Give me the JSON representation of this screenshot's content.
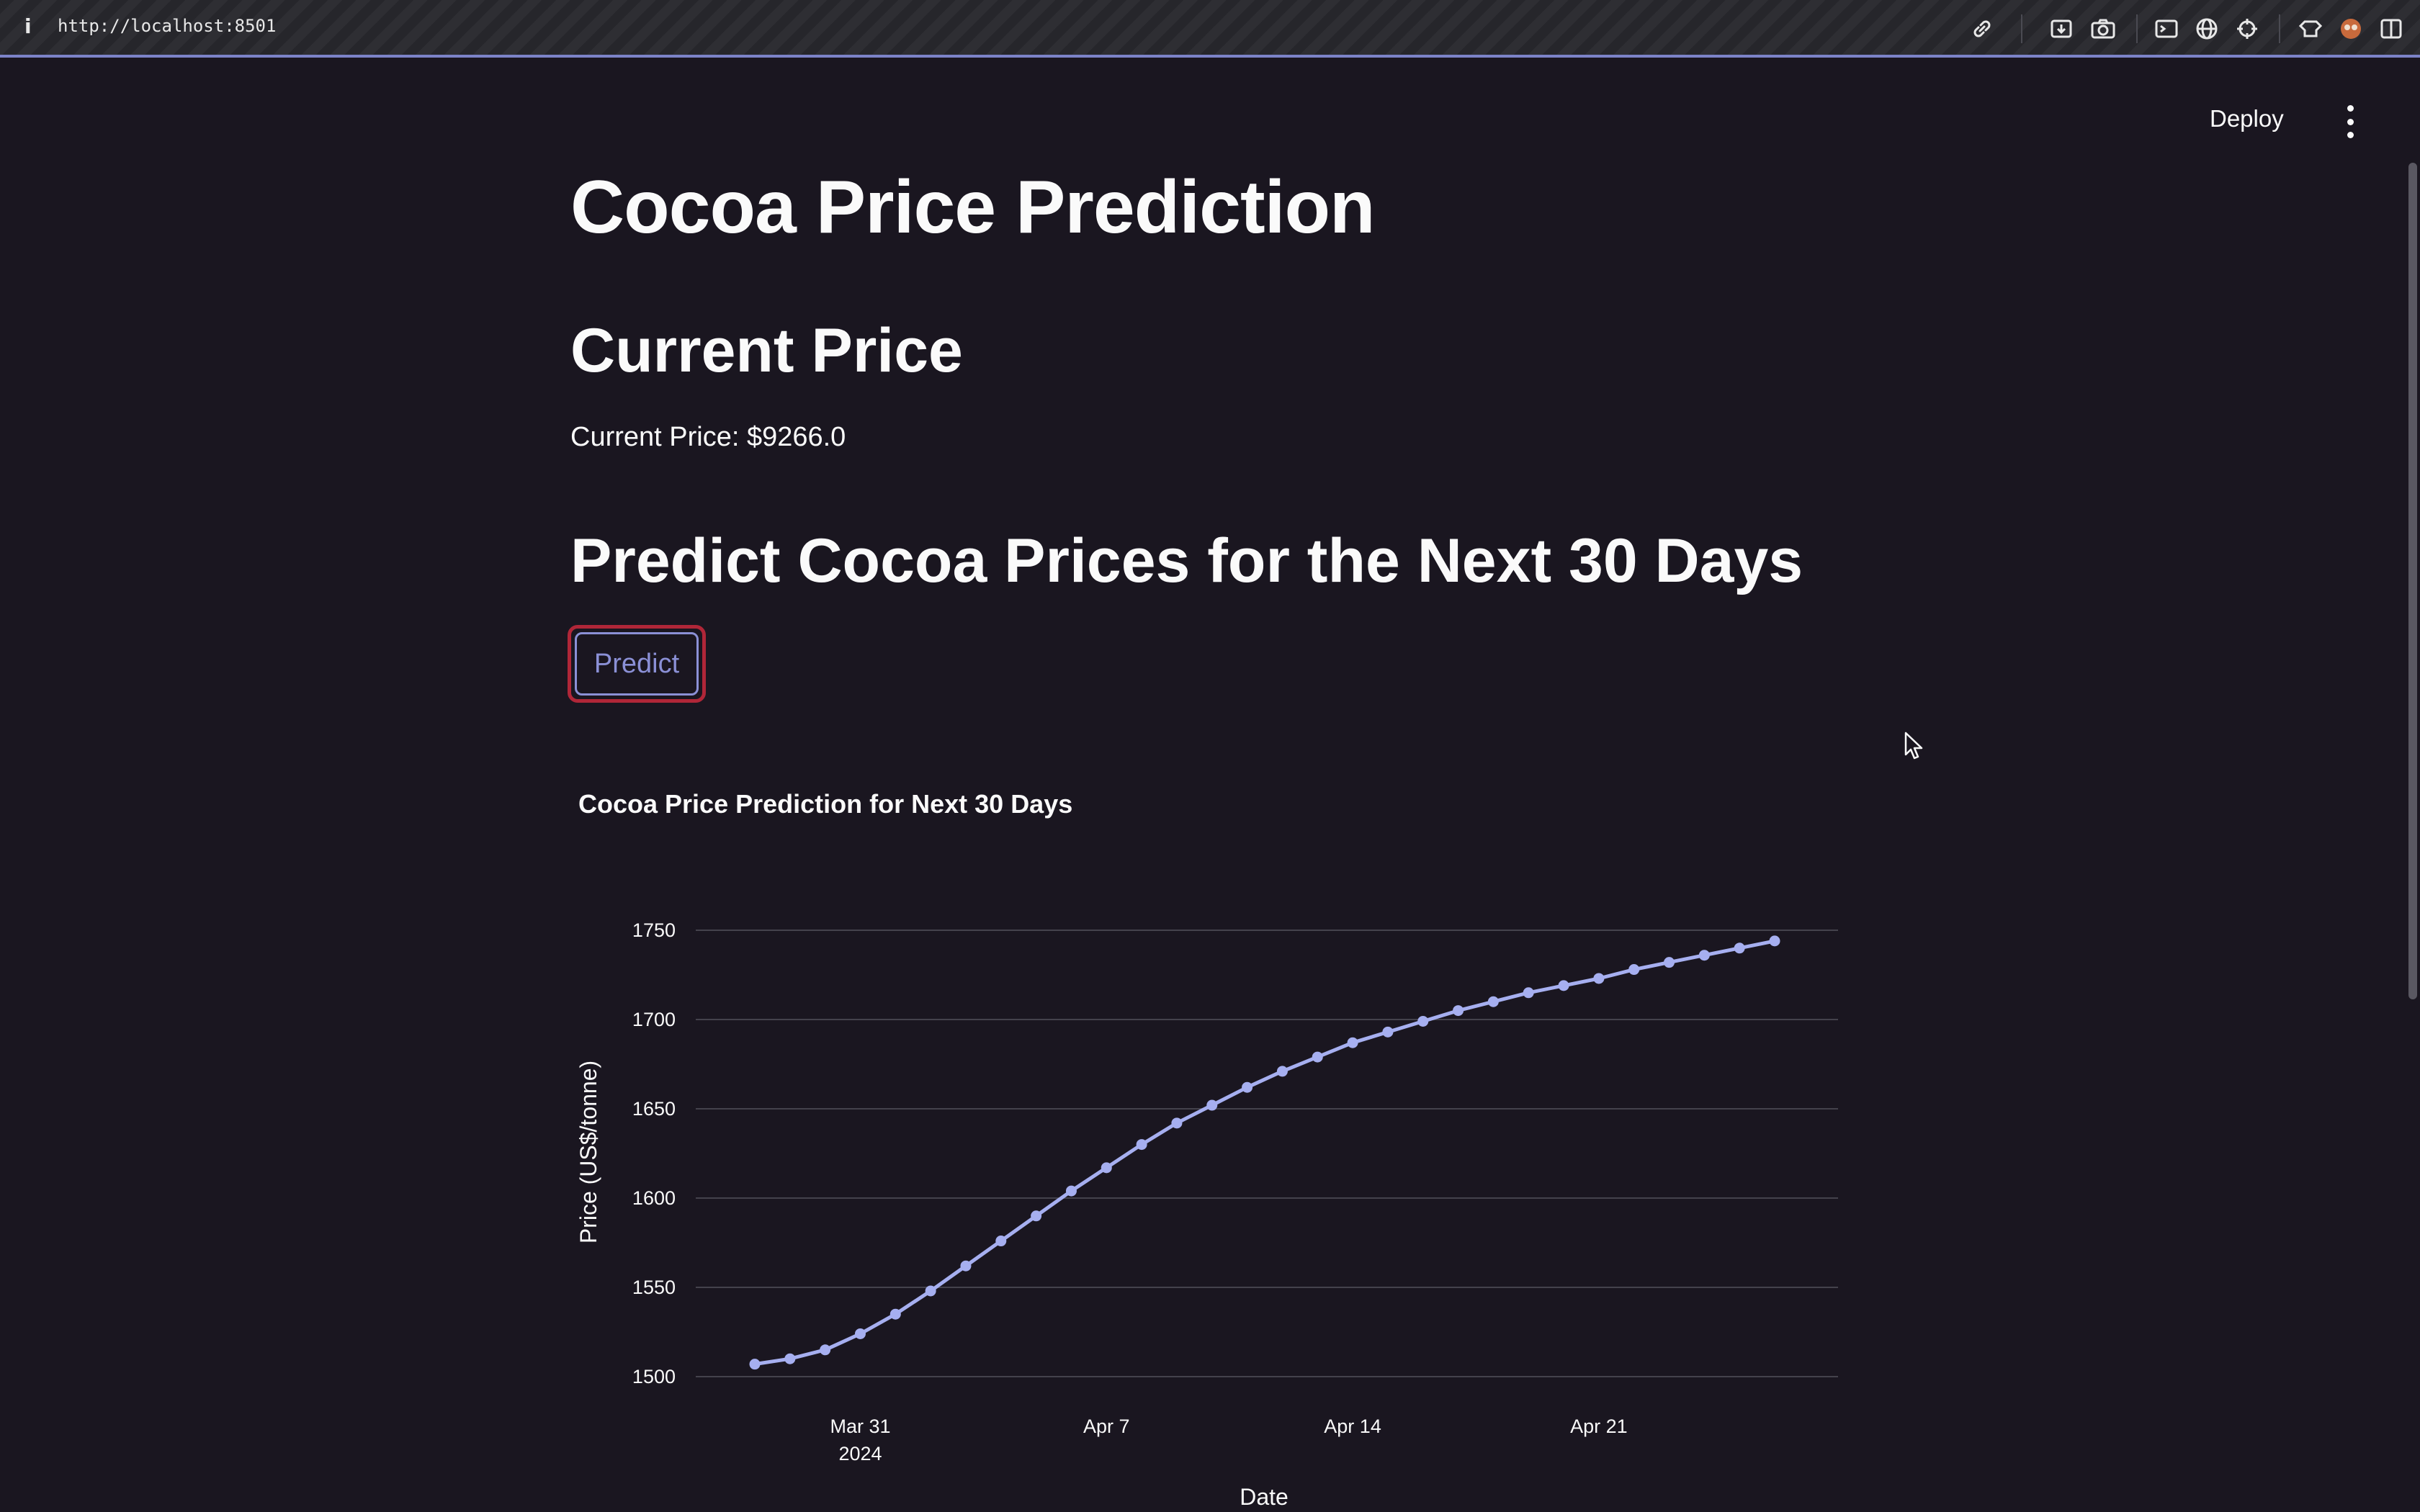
{
  "browser": {
    "info_icon": "i",
    "url": "http://localhost:8501",
    "toolbar_icons": [
      "link-icon",
      "download-icon",
      "camera-icon",
      "terminal-icon",
      "globe-icon",
      "crosshair-icon",
      "extension-icon",
      "avatar-icon",
      "sidebar-icon"
    ]
  },
  "app_header": {
    "deploy_label": "Deploy",
    "menu_icon": "kebab-menu-icon"
  },
  "main": {
    "title": "Cocoa Price Prediction",
    "current_heading": "Current Price",
    "current_price_text": "Current Price: $9266.0",
    "predict_heading": "Predict Cocoa Prices for the Next 30 Days",
    "predict_button": "Predict"
  },
  "colors": {
    "background": "#1a1620",
    "accent": "#8b90d6",
    "button_focus": "#b02638",
    "line": "#a6aff0"
  },
  "chart_data": {
    "type": "line",
    "title": "Cocoa Price Prediction for Next 30 Days",
    "xlabel": "Date",
    "ylabel": "Price (US$/tonne)",
    "ylim": [
      1500,
      1750
    ],
    "yticks": [
      "1500",
      "1550",
      "1600",
      "1650",
      "1700",
      "1750"
    ],
    "xticks": [
      {
        "date": "2024-03-31",
        "label": "Mar 31",
        "sublabel": "2024"
      },
      {
        "date": "2024-04-07",
        "label": "Apr 7",
        "sublabel": ""
      },
      {
        "date": "2024-04-14",
        "label": "Apr 14",
        "sublabel": ""
      },
      {
        "date": "2024-04-21",
        "label": "Apr 21",
        "sublabel": ""
      }
    ],
    "grid": true,
    "markers": true,
    "x": [
      "2024-03-28",
      "2024-03-29",
      "2024-03-30",
      "2024-03-31",
      "2024-04-01",
      "2024-04-02",
      "2024-04-03",
      "2024-04-04",
      "2024-04-05",
      "2024-04-06",
      "2024-04-07",
      "2024-04-08",
      "2024-04-09",
      "2024-04-10",
      "2024-04-11",
      "2024-04-12",
      "2024-04-13",
      "2024-04-14",
      "2024-04-15",
      "2024-04-16",
      "2024-04-17",
      "2024-04-18",
      "2024-04-19",
      "2024-04-20",
      "2024-04-21",
      "2024-04-22",
      "2024-04-23",
      "2024-04-24",
      "2024-04-25",
      "2024-04-26"
    ],
    "values": [
      1507,
      1510,
      1515,
      1524,
      1535,
      1548,
      1562,
      1576,
      1590,
      1604,
      1617,
      1630,
      1642,
      1652,
      1662,
      1671,
      1679,
      1687,
      1693,
      1699,
      1705,
      1710,
      1715,
      1719,
      1723,
      1728,
      1732,
      1736,
      1740,
      1744
    ]
  }
}
